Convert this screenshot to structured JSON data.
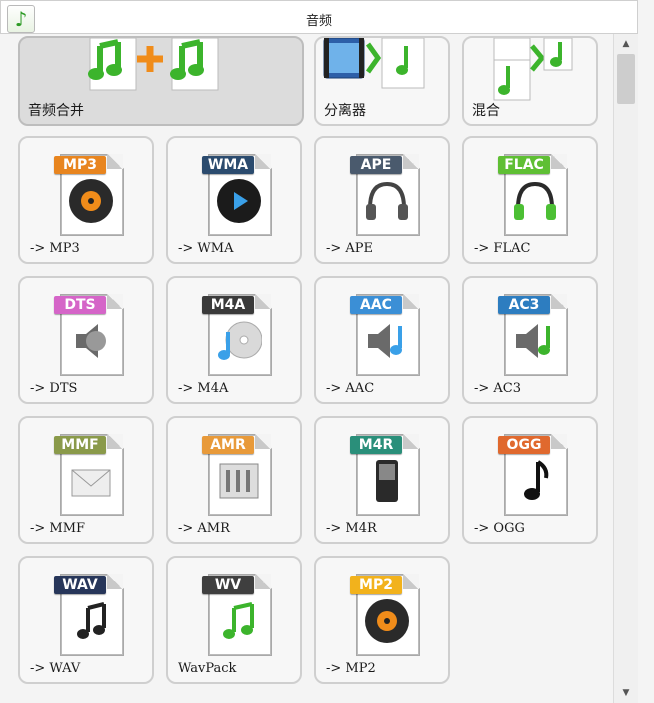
{
  "window": {
    "title": "音频",
    "app_icon": "music-note-icon"
  },
  "top_tiles": [
    {
      "id": "merge",
      "label": "音频合并",
      "selected": true,
      "icon": "audio-merge-icon"
    },
    {
      "id": "separator",
      "label": "分离器",
      "selected": false,
      "icon": "audio-separator-icon"
    },
    {
      "id": "mix",
      "label": "混合",
      "selected": false,
      "icon": "audio-mix-icon"
    }
  ],
  "formats": [
    {
      "tag": "MP3",
      "label": "-> MP3",
      "tab_color": "#e8851f",
      "art": "disc"
    },
    {
      "tag": "WMA",
      "label": "-> WMA",
      "tab_color": "#2b4b6e",
      "art": "media-disc"
    },
    {
      "tag": "APE",
      "label": "-> APE",
      "tab_color": "#4a5a6d",
      "art": "headphones-gray"
    },
    {
      "tag": "FLAC",
      "label": "-> FLAC",
      "tab_color": "#5fbf34",
      "art": "headphones-green"
    },
    {
      "tag": "DTS",
      "label": "-> DTS",
      "tab_color": "#d565c8",
      "art": "speaker"
    },
    {
      "tag": "M4A",
      "label": "-> M4A",
      "tab_color": "#3a3a3a",
      "art": "cd-note"
    },
    {
      "tag": "AAC",
      "label": "-> AAC",
      "tab_color": "#3b8fd6",
      "art": "speaker-note-blue"
    },
    {
      "tag": "AC3",
      "label": "-> AC3",
      "tab_color": "#2d7dc0",
      "art": "speaker-note-green"
    },
    {
      "tag": "MMF",
      "label": "-> MMF",
      "tab_color": "#8a9a4a",
      "art": "envelope"
    },
    {
      "tag": "AMR",
      "label": "-> AMR",
      "tab_color": "#e89a3a",
      "art": "mixer"
    },
    {
      "tag": "M4R",
      "label": "-> M4R",
      "tab_color": "#2a8f7a",
      "art": "phone"
    },
    {
      "tag": "OGG",
      "label": "-> OGG",
      "tab_color": "#e0692e",
      "art": "note-black"
    },
    {
      "tag": "WAV",
      "label": "-> WAV",
      "tab_color": "#27365a",
      "art": "notes-black"
    },
    {
      "tag": "WV",
      "label": "WavPack",
      "tab_color": "#3f3f3f",
      "art": "note-green"
    },
    {
      "tag": "MP2",
      "label": "-> MP2",
      "tab_color": "#f2b21c",
      "art": "disc"
    }
  ],
  "scrollbar": {
    "up": "▲",
    "down": "▼"
  }
}
